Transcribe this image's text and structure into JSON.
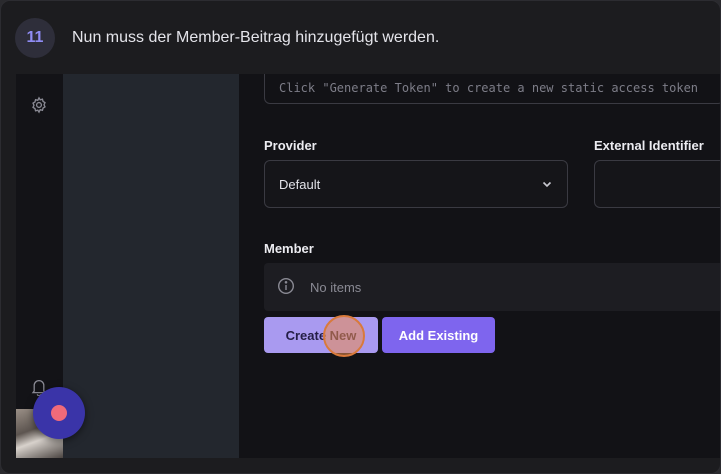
{
  "step": {
    "number": "11",
    "instruction": "Nun muss der Member-Beitrag hinzugefügt werden."
  },
  "form": {
    "token_placeholder": "Click \"Generate Token\" to create a new static access token",
    "provider": {
      "label": "Provider",
      "value": "Default"
    },
    "external_identifier": {
      "label": "External Identifier",
      "value": ""
    },
    "member": {
      "label": "Member",
      "empty_text": "No items"
    },
    "buttons": {
      "create_new": "Create New",
      "add_existing": "Add Existing"
    }
  },
  "icons": {
    "settings": "gear-icon",
    "notifications": "bell-icon",
    "info": "info-icon",
    "dropdown": "chevron-down-icon"
  },
  "colors": {
    "accent": "#7e65ee",
    "accent_light": "#a99af0",
    "highlight": "#d97a3b",
    "recorder_dot": "#f06a7a"
  }
}
